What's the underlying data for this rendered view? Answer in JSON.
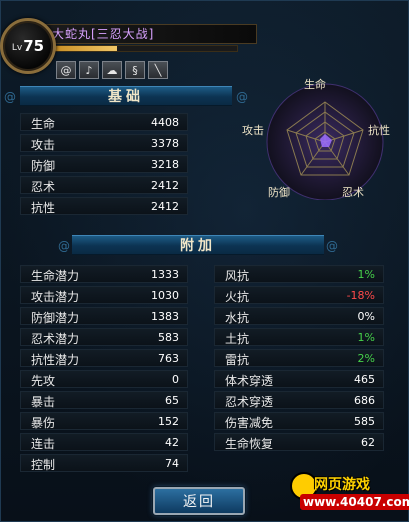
{
  "header": {
    "level_prefix": "Lv",
    "level": "75",
    "name": "大蛇丸[三忍大战]",
    "exp_fraction": 0.36
  },
  "skill_icons": [
    "wind-swirl-icon",
    "music-note-icon",
    "cloud-icon",
    "tornado-icon",
    "sword-icon"
  ],
  "basic": {
    "title": "基础",
    "rows": [
      {
        "label": "生命",
        "value": "4408"
      },
      {
        "label": "攻击",
        "value": "3378"
      },
      {
        "label": "防御",
        "value": "3218"
      },
      {
        "label": "忍术",
        "value": "2412"
      },
      {
        "label": "抗性",
        "value": "2412"
      }
    ]
  },
  "radar": {
    "labels": {
      "top": "生命",
      "right": "抗性",
      "bottom_right": "忍术",
      "bottom_left": "防御",
      "left": "攻击"
    }
  },
  "extra": {
    "title": "附加",
    "left_rows": [
      {
        "label": "生命潜力",
        "value": "1333"
      },
      {
        "label": "攻击潜力",
        "value": "1030"
      },
      {
        "label": "防御潜力",
        "value": "1383"
      },
      {
        "label": "忍术潜力",
        "value": "583"
      },
      {
        "label": "抗性潜力",
        "value": "763"
      },
      {
        "label": "先攻",
        "value": "0"
      },
      {
        "label": "暴击",
        "value": "65"
      },
      {
        "label": "暴伤",
        "value": "152"
      },
      {
        "label": "连击",
        "value": "42"
      },
      {
        "label": "控制",
        "value": "74"
      }
    ],
    "right_rows": [
      {
        "label": "风抗",
        "value": "1%",
        "color": "green"
      },
      {
        "label": "火抗",
        "value": "-18%",
        "color": "red"
      },
      {
        "label": "水抗",
        "value": "0%",
        "color": "white"
      },
      {
        "label": "土抗",
        "value": "1%",
        "color": "green"
      },
      {
        "label": "雷抗",
        "value": "2%",
        "color": "green"
      },
      {
        "label": "体术穿透",
        "value": "465",
        "color": "white"
      },
      {
        "label": "忍术穿透",
        "value": "686",
        "color": "white"
      },
      {
        "label": "伤害减免",
        "value": "585",
        "color": "white"
      },
      {
        "label": "生命恢复",
        "value": "62",
        "color": "white"
      }
    ]
  },
  "footer": {
    "back_label": "返回",
    "watermark_line1": "网页游戏",
    "watermark_line2": "www.40407.com"
  }
}
